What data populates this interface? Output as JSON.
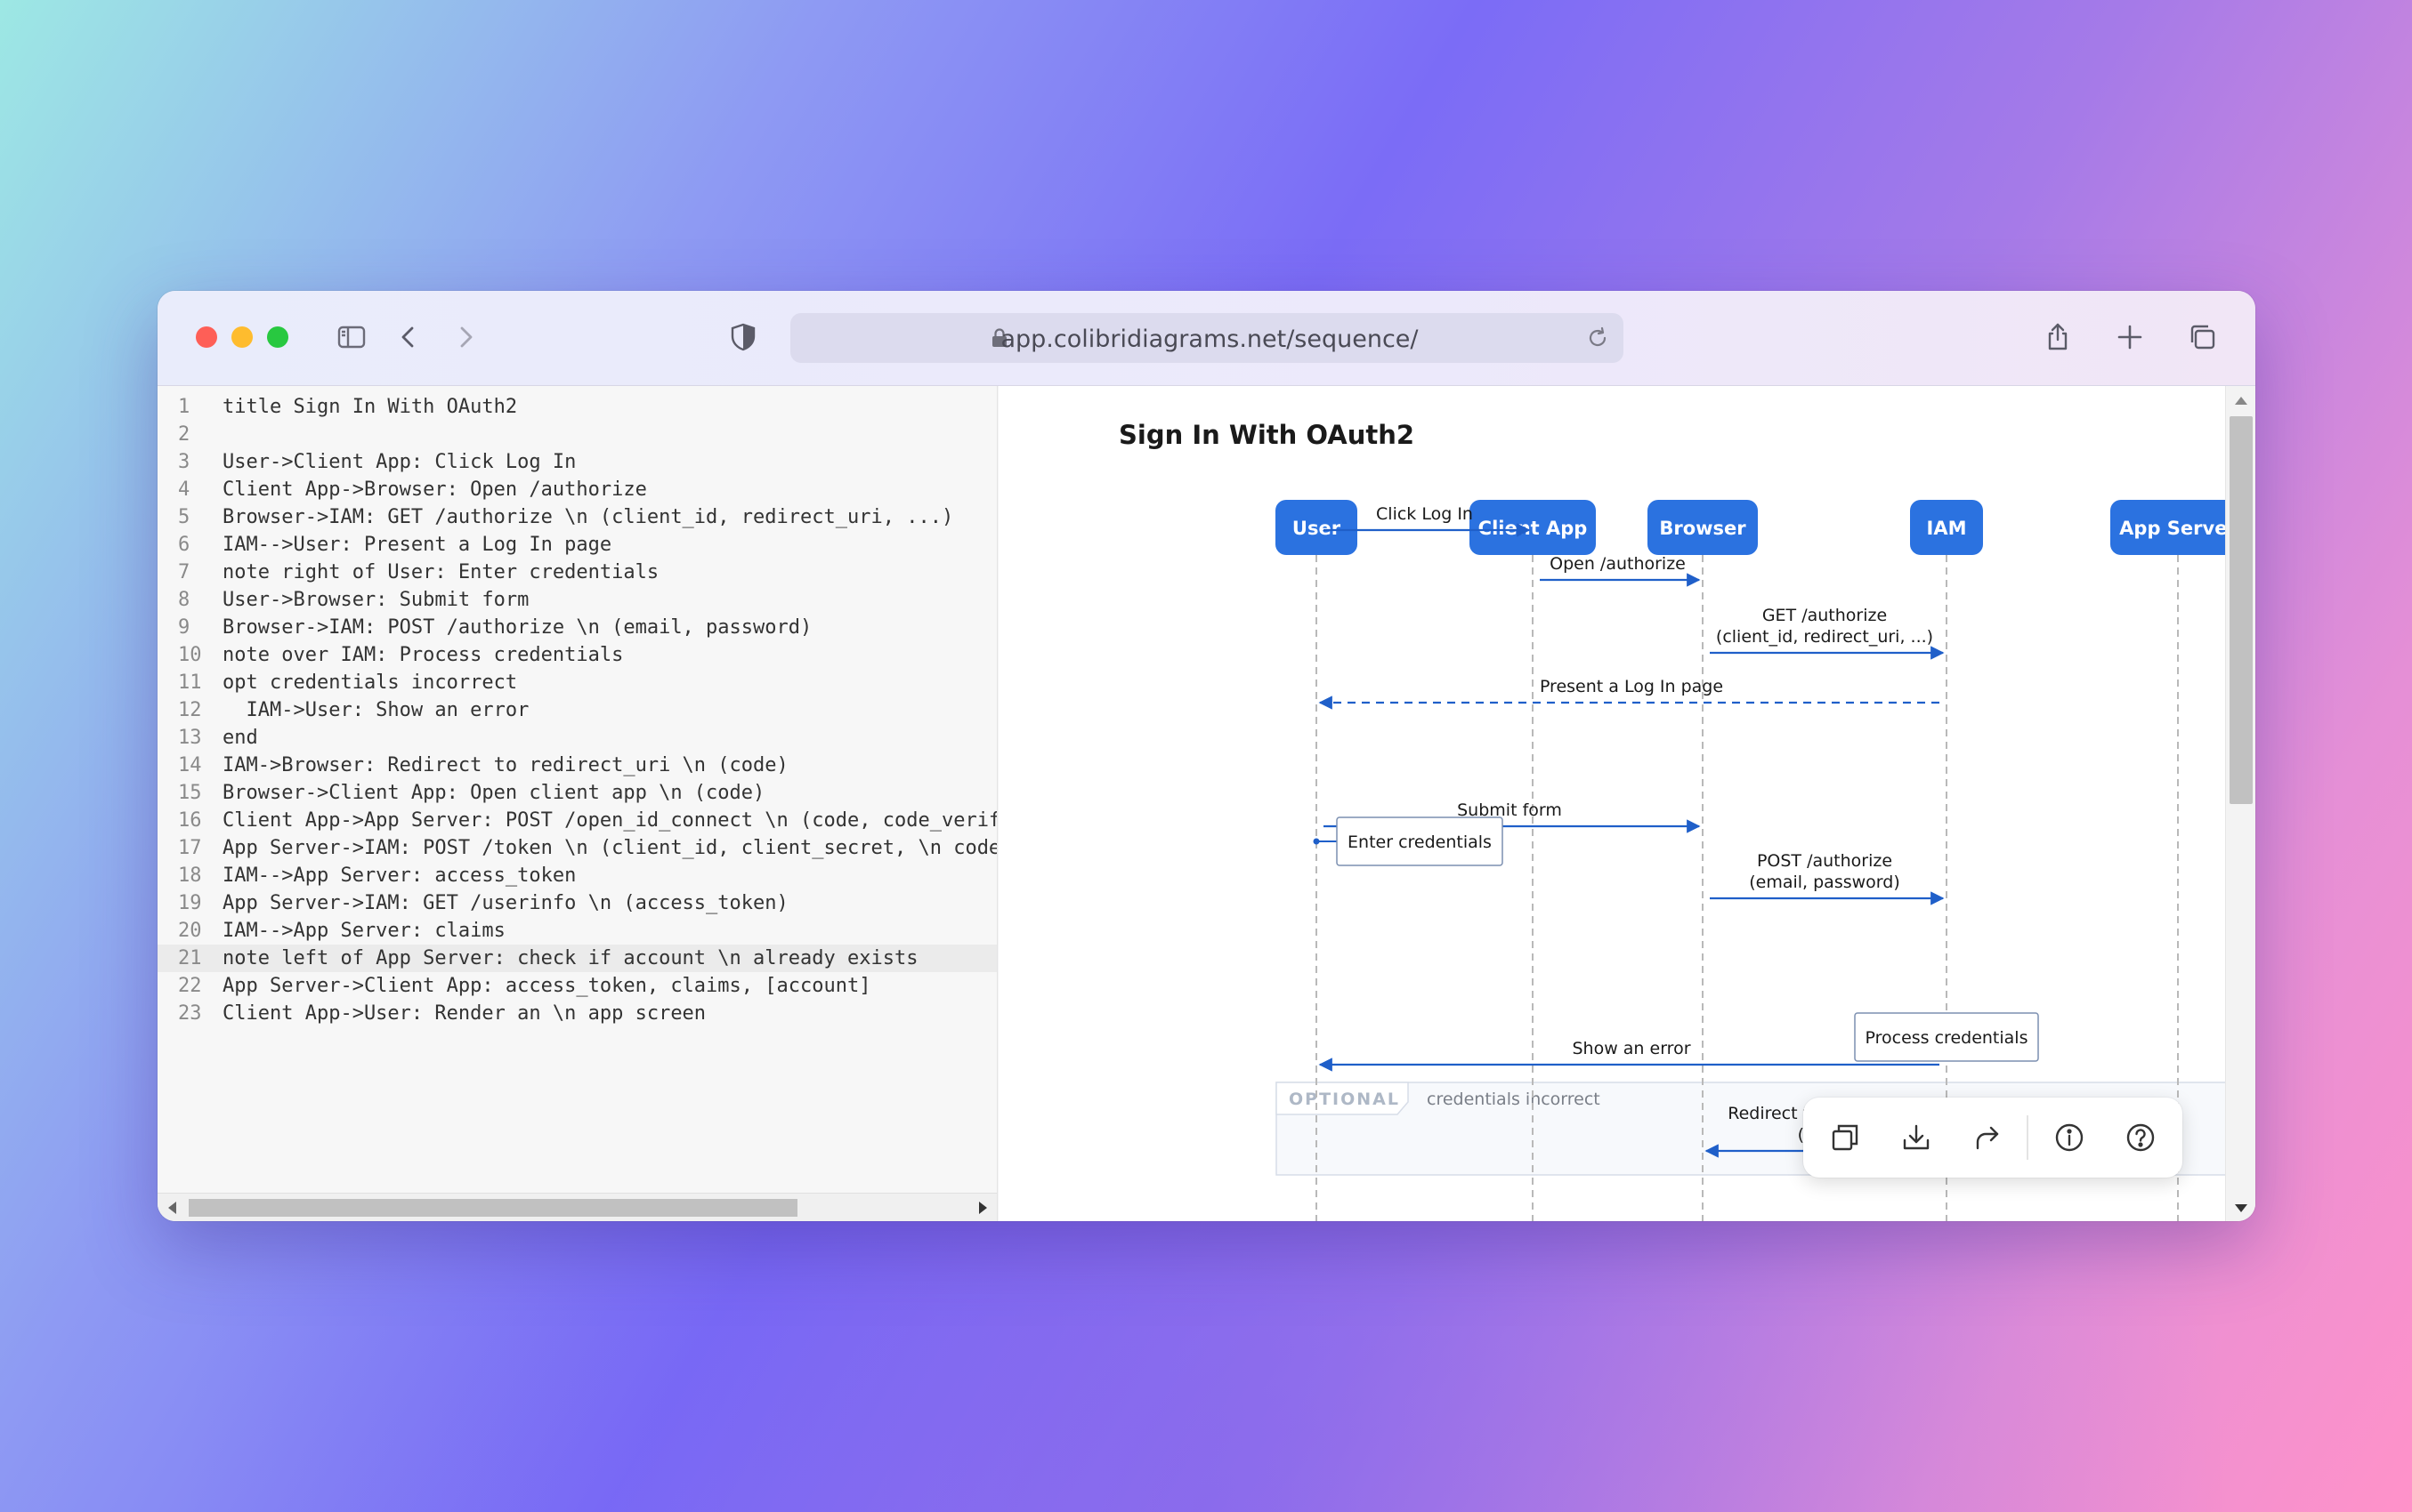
{
  "browser": {
    "url": "app.colibridiagrams.net/sequence/",
    "icons": [
      "sidebar-icon",
      "back-icon",
      "forward-icon",
      "shield-icon",
      "lock-icon",
      "reload-icon",
      "share-icon",
      "new-tab-icon",
      "tabs-overview-icon"
    ]
  },
  "editor": {
    "active_line": 21,
    "lines": [
      {
        "n": "1",
        "text": "title Sign In With OAuth2"
      },
      {
        "n": "2",
        "text": ""
      },
      {
        "n": "3",
        "text": "User->Client App: Click Log In"
      },
      {
        "n": "4",
        "text": "Client App->Browser: Open /authorize"
      },
      {
        "n": "5",
        "text": "Browser->IAM: GET /authorize \\n (client_id, redirect_uri, ...)"
      },
      {
        "n": "6",
        "text": "IAM-->User: Present a Log In page"
      },
      {
        "n": "7",
        "text": "note right of User: Enter credentials"
      },
      {
        "n": "8",
        "text": "User->Browser: Submit form"
      },
      {
        "n": "9",
        "text": "Browser->IAM: POST /authorize \\n (email, password)"
      },
      {
        "n": "10",
        "text": "note over IAM: Process credentials"
      },
      {
        "n": "11",
        "text": "opt credentials incorrect"
      },
      {
        "n": "12",
        "text": "  IAM->User: Show an error"
      },
      {
        "n": "13",
        "text": "end"
      },
      {
        "n": "14",
        "text": "IAM->Browser: Redirect to redirect_uri \\n (code)"
      },
      {
        "n": "15",
        "text": "Browser->Client App: Open client app \\n (code)"
      },
      {
        "n": "16",
        "text": "Client App->App Server: POST /open_id_connect \\n (code, code_verif"
      },
      {
        "n": "17",
        "text": "App Server->IAM: POST /token \\n (client_id, client_secret, \\n code"
      },
      {
        "n": "18",
        "text": "IAM-->App Server: access_token"
      },
      {
        "n": "19",
        "text": "App Server->IAM: GET /userinfo \\n (access_token)"
      },
      {
        "n": "20",
        "text": "IAM-->App Server: claims"
      },
      {
        "n": "21",
        "text": "note left of App Server: check if account \\n already exists"
      },
      {
        "n": "22",
        "text": "App Server->Client App: access_token, claims, [account]"
      },
      {
        "n": "23",
        "text": "Client App->User: Render an \\n app screen"
      }
    ]
  },
  "diagram": {
    "title": "Sign In With OAuth2",
    "actors": [
      "User",
      "Client App",
      "Browser",
      "IAM",
      "App Server"
    ],
    "messages": [
      {
        "from": 0,
        "to": 1,
        "lines": [
          "Click Log In"
        ],
        "dashed": false
      },
      {
        "from": 1,
        "to": 2,
        "lines": [
          "Open /authorize"
        ],
        "dashed": false
      },
      {
        "from": 2,
        "to": 3,
        "lines": [
          "GET /authorize",
          "(client_id, redirect_uri, ...)"
        ],
        "dashed": false
      },
      {
        "from": 3,
        "to": 0,
        "lines": [
          "Present a Log In page"
        ],
        "dashed": true
      },
      {
        "from": 0,
        "to": 2,
        "lines": [
          "Submit form"
        ],
        "dashed": false
      },
      {
        "from": 2,
        "to": 3,
        "lines": [
          "POST /authorize",
          "(email, password)"
        ],
        "dashed": false
      },
      {
        "from": 3,
        "to": 0,
        "lines": [
          "Show an error"
        ],
        "dashed": false
      },
      {
        "from": 3,
        "to": 2,
        "lines": [
          "Redirect to redirect_uri",
          "(code)"
        ],
        "dashed": false
      }
    ],
    "notes": [
      {
        "actor": 0,
        "placement": "right",
        "text": "Enter credentials"
      },
      {
        "actor": 3,
        "placement": "over",
        "text": "Process credentials"
      }
    ],
    "opt_block": {
      "label": "OPTIONAL",
      "condition": "credentials incorrect"
    },
    "colors": {
      "actor": "#2b72e0",
      "arrow": "#1f5fc9",
      "lifeline": "#b9b9b9"
    }
  },
  "floating_toolbar": {
    "buttons": [
      "copy-icon",
      "download-icon",
      "share-arrow-icon",
      "info-icon",
      "help-icon"
    ]
  }
}
